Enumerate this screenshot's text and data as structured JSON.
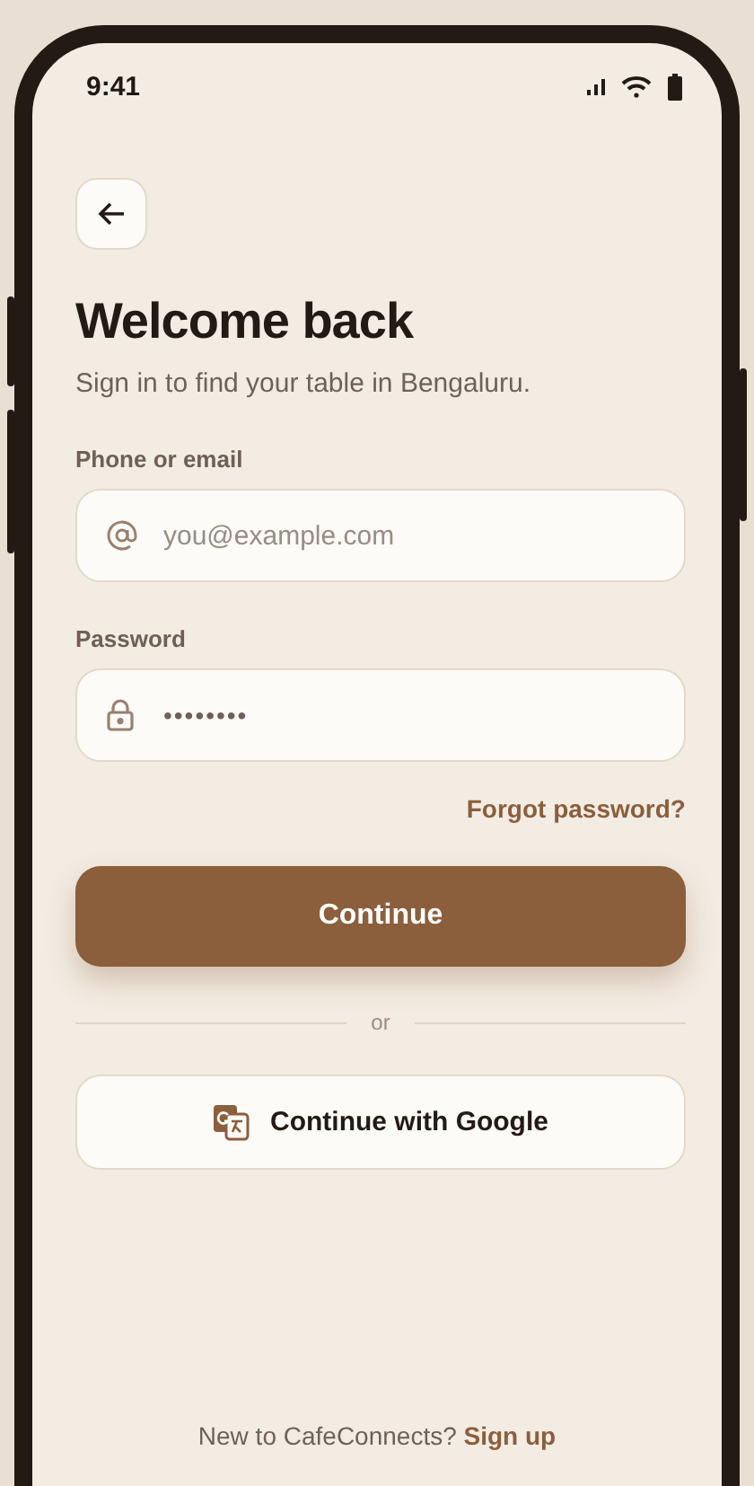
{
  "status_bar": {
    "time": "9:41"
  },
  "title": "Welcome back",
  "subtitle": "Sign in to find your table in Bengaluru.",
  "fields": [
    {
      "label": "Phone or email",
      "kind": "email",
      "placeholder": "you@example.com"
    },
    {
      "label": "Password",
      "kind": "password",
      "value": "••••••••"
    }
  ],
  "forgot_link": "Forgot password?",
  "primary_button": "Continue",
  "divider": "or",
  "google_button": "Continue with Google",
  "footer": {
    "text": "New to CafeConnects?",
    "link": "Sign up"
  }
}
